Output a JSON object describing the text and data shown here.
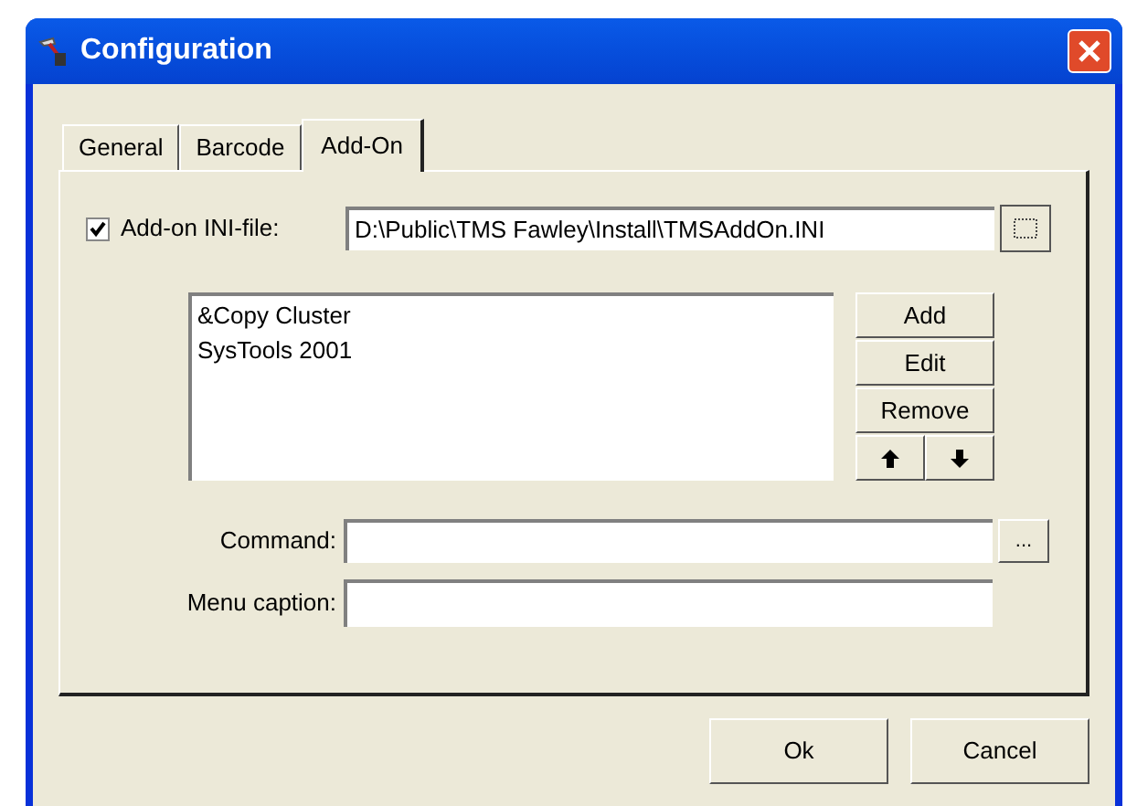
{
  "window": {
    "title": "Configuration"
  },
  "tabs": [
    {
      "label": "General",
      "selected": false
    },
    {
      "label": "Barcode",
      "selected": false
    },
    {
      "label": "Add-On",
      "selected": true
    }
  ],
  "ini_file": {
    "label": "Add-on INI-file:",
    "checked": true,
    "value": "D:\\Public\\TMS Fawley\\Install\\TMSAddOn.INI"
  },
  "addons": [
    {
      "label": "&Copy Cluster"
    },
    {
      "label": "SysTools 2001"
    }
  ],
  "list_buttons": [
    "Add",
    "Edit",
    "Remove"
  ],
  "command": {
    "label": "Command:",
    "browse": "..."
  },
  "menu_caption": {
    "label": "Menu caption:"
  },
  "buttons": [
    "Ok",
    "Cancel"
  ]
}
